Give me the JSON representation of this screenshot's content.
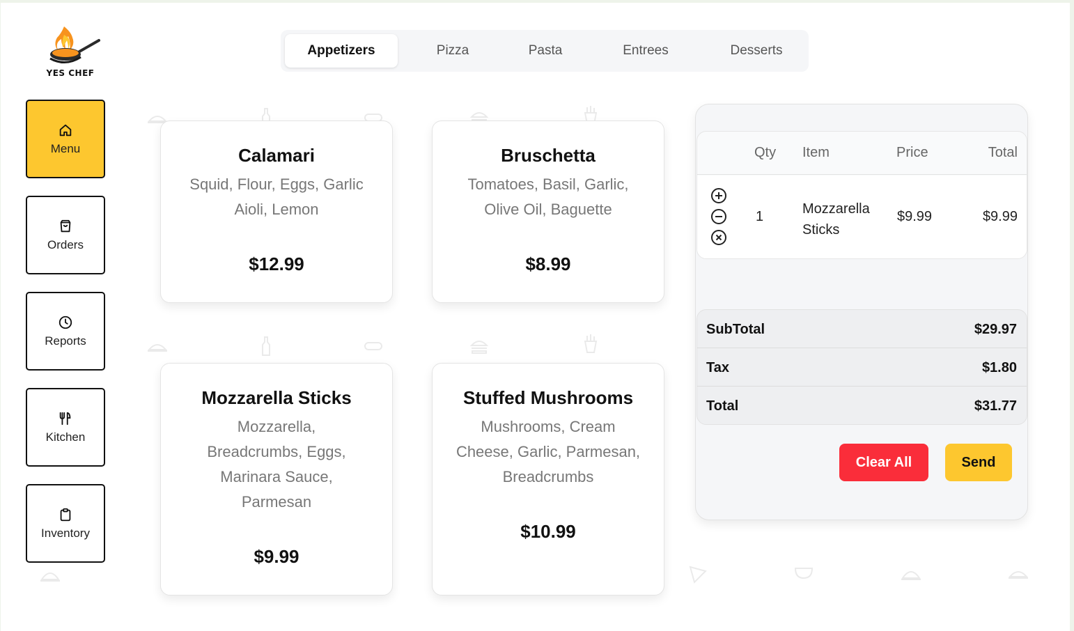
{
  "brand": {
    "name": "YES CHEF",
    "logo_icon": "flaming-pan-icon"
  },
  "sidebar": {
    "items": [
      {
        "label": "Menu",
        "icon": "home-icon",
        "active": true
      },
      {
        "label": "Orders",
        "icon": "bag-icon",
        "active": false
      },
      {
        "label": "Reports",
        "icon": "clock-icon",
        "active": false
      },
      {
        "label": "Kitchen",
        "icon": "utensils-icon",
        "active": false
      },
      {
        "label": "Inventory",
        "icon": "clipboard-icon",
        "active": false
      }
    ]
  },
  "tabs": [
    {
      "label": "Appetizers",
      "active": true
    },
    {
      "label": "Pizza",
      "active": false
    },
    {
      "label": "Pasta",
      "active": false
    },
    {
      "label": "Entrees",
      "active": false
    },
    {
      "label": "Desserts",
      "active": false
    }
  ],
  "menu_items": [
    {
      "name": "Calamari",
      "ingredients": "Squid, Flour, Eggs, Garlic Aioli, Lemon",
      "price": "$12.99"
    },
    {
      "name": "Bruschetta",
      "ingredients": "Tomatoes, Basil, Garlic, Olive Oil, Baguette",
      "price": "$8.99"
    },
    {
      "name": "Mozzarella Sticks",
      "ingredients": "Mozzarella, Breadcrumbs, Eggs, Marinara Sauce, Parmesan",
      "price": "$9.99"
    },
    {
      "name": "Stuffed Mushrooms",
      "ingredients": "Mushrooms, Cream Cheese, Garlic, Parmesan, Breadcrumbs",
      "price": "$10.99"
    }
  ],
  "order": {
    "headers": {
      "qty": "Qty",
      "item": "Item",
      "price": "Price",
      "total": "Total"
    },
    "rows": [
      {
        "qty": "1",
        "item": "Mozzarella Sticks",
        "price": "$9.99",
        "total": "$9.99"
      }
    ],
    "row_controls": [
      "add-circle-icon",
      "minus-circle-icon",
      "remove-circle-icon"
    ],
    "subtotal_label": "SubTotal",
    "subtotal": "$29.97",
    "tax_label": "Tax",
    "tax": "$1.80",
    "total_label": "Total",
    "total": "$31.77",
    "clear_label": "Clear All",
    "send_label": "Send"
  },
  "colors": {
    "accent_yellow": "#fdc72f",
    "danger_red": "#fa2d3a",
    "page_bg": "#ffffff"
  }
}
